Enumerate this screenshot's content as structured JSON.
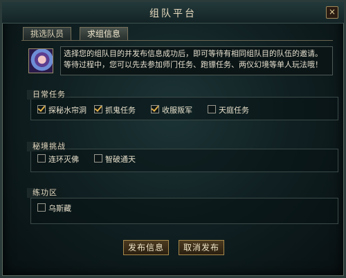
{
  "window": {
    "title": "组队平台",
    "close_glyph": "×"
  },
  "tabs": [
    {
      "label": "挑选队员"
    },
    {
      "label": "求组信息"
    }
  ],
  "description": "选择您的组队目的并发布信息成功后，即可等待有相同组队目的队伍的邀请。等待过程中，您可以先去参加师门任务、跑镖任务、两仪幻境等单人玩法哦！",
  "sections": {
    "daily": {
      "title": "日常任务",
      "items": [
        {
          "label": "探秘水帘洞",
          "checked": true
        },
        {
          "label": "抓鬼任务",
          "checked": true
        },
        {
          "label": "收服叛军",
          "checked": true
        },
        {
          "label": "天庭任务",
          "checked": false
        }
      ]
    },
    "secret": {
      "title": "秘境挑战",
      "items": [
        {
          "label": "连环灭佛",
          "checked": false
        },
        {
          "label": "智破通天",
          "checked": false
        }
      ]
    },
    "practice": {
      "title": "练功区",
      "items": [
        {
          "label": "乌斯藏",
          "checked": false
        }
      ]
    }
  },
  "buttons": {
    "publish": "发布信息",
    "cancel": "取消发布"
  }
}
